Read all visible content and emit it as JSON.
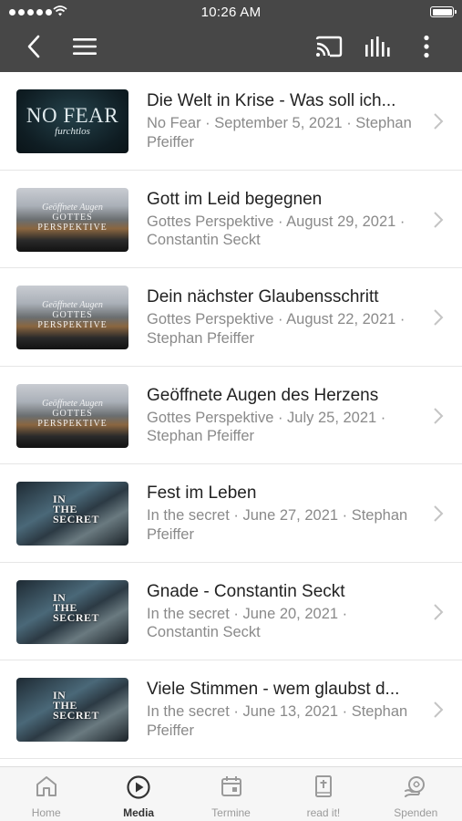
{
  "status_bar": {
    "time": "10:26 AM"
  },
  "header": {
    "back_icon": "chevron-left-icon",
    "menu_icon": "hamburger-menu-icon",
    "cast_icon": "cast-icon",
    "audio_icon": "equalizer-icon",
    "more_icon": "more-vertical-icon"
  },
  "media_list": [
    {
      "title": "Die Welt in Krise - Was soll ich...",
      "meta": "No Fear · September 5, 2021 · Stephan Pfeiffer",
      "thumb": "nofear",
      "thumb_text": "NO FEAR",
      "thumb_sub": "furchtlos"
    },
    {
      "title": "Gott im Leid begegnen",
      "meta": "Gottes Perspektive · August 29, 2021 · Constantin Seckt",
      "thumb": "gp",
      "thumb_text": "GOTTES PERSPEKTIVE",
      "thumb_sub": "Geöffnete Augen"
    },
    {
      "title": "Dein nächster Glaubensschritt",
      "meta": "Gottes Perspektive · August 22, 2021 · Stephan Pfeiffer",
      "thumb": "gp",
      "thumb_text": "GOTTES PERSPEKTIVE",
      "thumb_sub": "Geöffnete Augen"
    },
    {
      "title": "Geöffnete Augen des Herzens",
      "meta": "Gottes Perspektive · July 25, 2021 · Stephan Pfeiffer",
      "thumb": "gp",
      "thumb_text": "GOTTES PERSPEKTIVE",
      "thumb_sub": "Geöffnete Augen"
    },
    {
      "title": "Fest im Leben",
      "meta": "In the secret · June 27, 2021 · Stephan Pfeiffer",
      "thumb": "secret",
      "thumb_text": "IN THE SECRET",
      "thumb_sub": ""
    },
    {
      "title": "Gnade - Constantin Seckt",
      "meta": "In the secret · June 20, 2021 · Constantin Seckt",
      "thumb": "secret",
      "thumb_text": "IN THE SECRET",
      "thumb_sub": ""
    },
    {
      "title": "Viele Stimmen - wem glaubst d...",
      "meta": "In the secret · June 13, 2021 · Stephan Pfeiffer",
      "thumb": "secret",
      "thumb_text": "IN THE SECRET",
      "thumb_sub": ""
    }
  ],
  "tabs": [
    {
      "label": "Home",
      "icon": "home-icon",
      "active": false
    },
    {
      "label": "Media",
      "icon": "play-circle-icon",
      "active": true
    },
    {
      "label": "Termine",
      "icon": "calendar-icon",
      "active": false
    },
    {
      "label": "read it!",
      "icon": "bible-icon",
      "active": false
    },
    {
      "label": "Spenden",
      "icon": "donate-icon",
      "active": false
    }
  ],
  "colors": {
    "header_bg": "#474747",
    "tab_active": "#333333",
    "tab_inactive": "#9a9a9a"
  }
}
